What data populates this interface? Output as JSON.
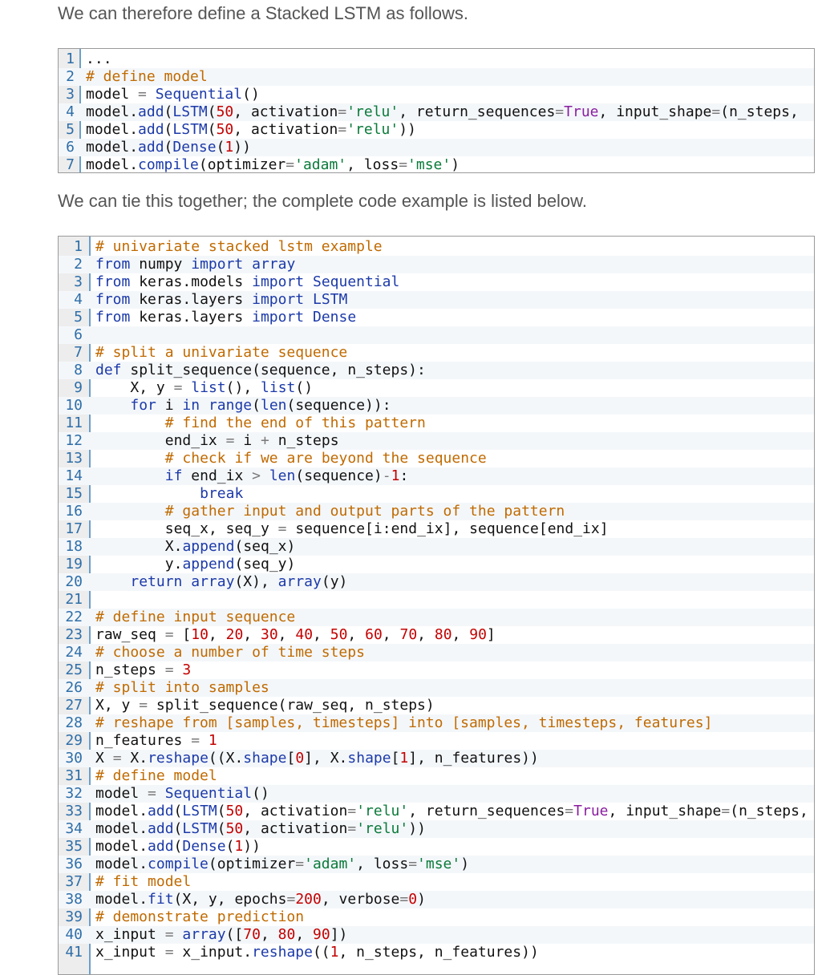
{
  "paragraphs": {
    "intro": "We can therefore define a Stacked LSTM as follows.",
    "complete": "We can tie this together; the complete code example is listed below."
  },
  "code_blocks": [
    {
      "language": "python",
      "lines": [
        "...",
        "# define model",
        "model = Sequential()",
        "model.add(LSTM(50, activation='relu', return_sequences=True, input_shape=(n_steps,",
        "model.add(LSTM(50, activation='relu'))",
        "model.add(Dense(1))",
        "model.compile(optimizer='adam', loss='mse')"
      ]
    },
    {
      "language": "python",
      "lines": [
        "# univariate stacked lstm example",
        "from numpy import array",
        "from keras.models import Sequential",
        "from keras.layers import LSTM",
        "from keras.layers import Dense",
        "",
        "# split a univariate sequence",
        "def split_sequence(sequence, n_steps):",
        "    X, y = list(), list()",
        "    for i in range(len(sequence)):",
        "        # find the end of this pattern",
        "        end_ix = i + n_steps",
        "        # check if we are beyond the sequence",
        "        if end_ix > len(sequence)-1:",
        "            break",
        "        # gather input and output parts of the pattern",
        "        seq_x, seq_y = sequence[i:end_ix], sequence[end_ix]",
        "        X.append(seq_x)",
        "        y.append(seq_y)",
        "    return array(X), array(y)",
        "",
        "# define input sequence",
        "raw_seq = [10, 20, 30, 40, 50, 60, 70, 80, 90]",
        "# choose a number of time steps",
        "n_steps = 3",
        "# split into samples",
        "X, y = split_sequence(raw_seq, n_steps)",
        "# reshape from [samples, timesteps] into [samples, timesteps, features]",
        "n_features = 1",
        "X = X.reshape((X.shape[0], X.shape[1], n_features))",
        "# define model",
        "model = Sequential()",
        "model.add(LSTM(50, activation='relu', return_sequences=True, input_shape=(n_steps,",
        "model.add(LSTM(50, activation='relu'))",
        "model.add(Dense(1))",
        "model.compile(optimizer='adam', loss='mse')",
        "# fit model",
        "model.fit(X, y, epochs=200, verbose=0)",
        "# demonstrate prediction",
        "x_input = array([70, 80, 90])",
        "x_input = x_input.reshape((1, n_steps, n_features))"
      ]
    }
  ],
  "colors": {
    "comment": "#c06a00",
    "keyword": "#1c3aa9",
    "string": "#0a7a3a",
    "number": "#c40000",
    "builtin_const": "#8a1ea0",
    "line_number": "#2e6ea8",
    "gutter_bg": "#ededed",
    "gutter_border": "#6ca0c8"
  }
}
